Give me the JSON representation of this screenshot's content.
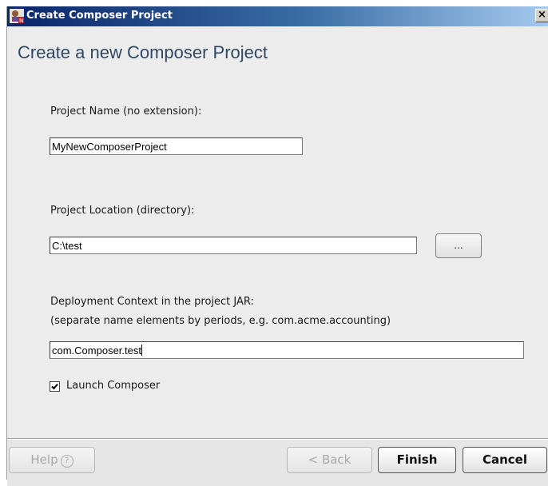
{
  "window": {
    "title": "Create Composer Project",
    "close_glyph": "×",
    "app_icon": "composer-app-icon"
  },
  "page": {
    "heading": "Create a new Composer Project"
  },
  "project_name": {
    "label": "Project Name (no extension):",
    "value": "MyNewComposerProject"
  },
  "project_location": {
    "label": "Project Location (directory):",
    "value": "C:\\test",
    "browse_label": "..."
  },
  "deployment_context": {
    "label": "Deployment Context in the project JAR:",
    "hint": "(separate name elements by periods, e.g. com.acme.accounting)",
    "value": "com.Composer.test"
  },
  "launch_composer": {
    "label": "Launch Composer",
    "checked": true
  },
  "footer": {
    "help_label": "Help",
    "help_icon_glyph": "?",
    "back_label": "< Back",
    "finish_label": "Finish",
    "cancel_label": "Cancel"
  }
}
